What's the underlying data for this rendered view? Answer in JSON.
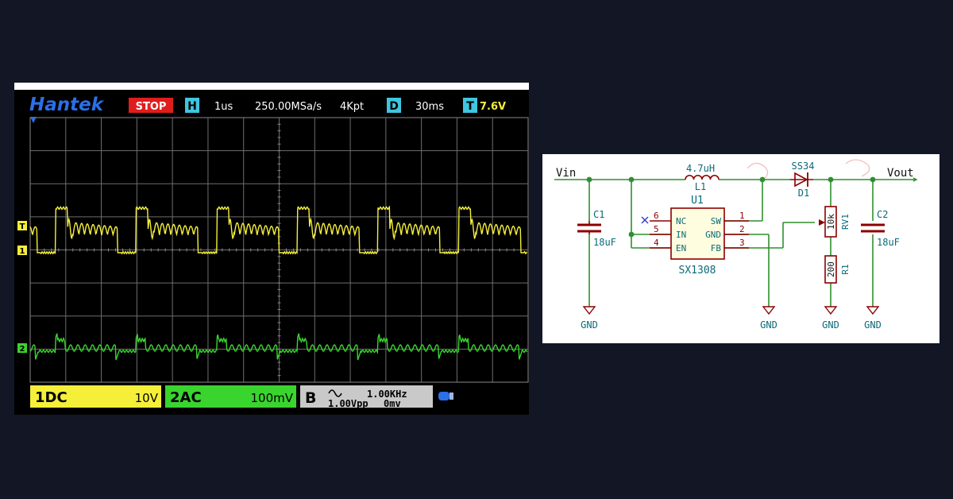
{
  "scope": {
    "brand": "Hantek",
    "status": "STOP",
    "horiz_icon": "H",
    "timebase": "1us",
    "sample_rate": "250.00MSa/s",
    "memory_depth": "4Kpt",
    "delay_icon": "D",
    "delay": "30ms",
    "trigger_icon": "T",
    "trigger_level": "7.6V",
    "ch1_marker": "1",
    "trig_marker": "T",
    "ch2_marker": "2",
    "ch1": {
      "label": "1DC",
      "scale": "10V",
      "color": "#f5ef3a"
    },
    "ch2": {
      "label": "2AC",
      "scale": "100mV",
      "color": "#3ad42f"
    },
    "gen": {
      "channel": "B",
      "wave_icon": "sine-wave-icon",
      "freq": "1.00KHz",
      "amp": "1.00Vpp",
      "offset": "0mv"
    },
    "usb_icon": "usb-icon"
  },
  "schematic": {
    "vin": "Vin",
    "vout": "Vout",
    "inductor_value": "4.7uH",
    "inductor_ref": "L1",
    "ic_ref": "U1",
    "ic_name": "SX1308",
    "diode_part": "SS34",
    "diode_ref": "D1",
    "c1_ref": "C1",
    "c1_value": "18uF",
    "c2_ref": "C2",
    "c2_value": "18uF",
    "rv1_ref": "RV1",
    "rv1_value": "10k",
    "r1_ref": "R1",
    "r1_value": "200",
    "pins_left": [
      {
        "num": "6",
        "name": "NC"
      },
      {
        "num": "5",
        "name": "IN"
      },
      {
        "num": "4",
        "name": "EN"
      }
    ],
    "pins_right": [
      {
        "num": "1",
        "name": "SW"
      },
      {
        "num": "2",
        "name": "GND"
      },
      {
        "num": "3",
        "name": "FB"
      }
    ],
    "gnd_labels": [
      "GND",
      "GND",
      "GND",
      "GND"
    ],
    "wire_color": "#2e8f2e",
    "part_color": "#8b0000",
    "text_color": "#0a6a78"
  }
}
